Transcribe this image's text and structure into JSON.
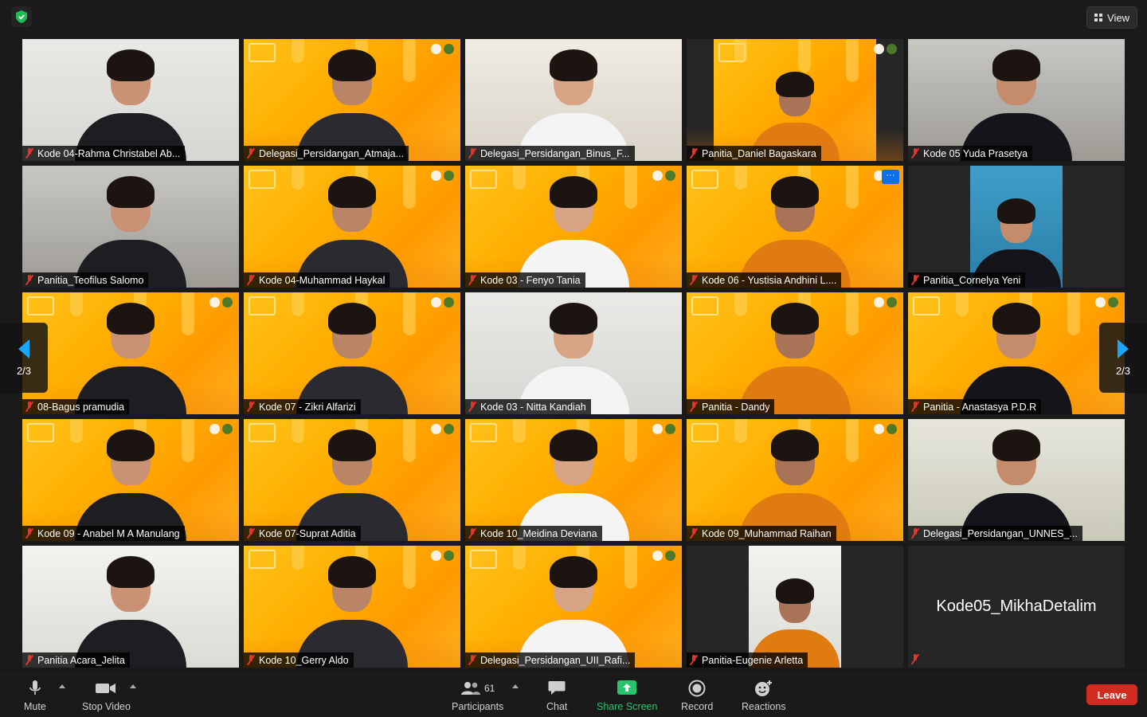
{
  "app": {
    "view_label": "View"
  },
  "pager": {
    "left": "2/3",
    "right": "2/3"
  },
  "tiles": [
    {
      "name": "Kode 04-Rahma Christabel Ab...",
      "bg": "white"
    },
    {
      "name": "Delegasi_Persidangan_Atmaja...",
      "bg": "orange"
    },
    {
      "name": "Delegasi_Persidangan_Binus_F...",
      "bg": "wood"
    },
    {
      "name": "Panitia_Daniel Bagaskara",
      "bg": "orange-inset"
    },
    {
      "name": "Kode 05 Yuda Prasetya",
      "bg": "room"
    },
    {
      "name": "Panitia_Teofilus Salomo",
      "bg": "room"
    },
    {
      "name": "Kode 04-Muhammad Haykal",
      "bg": "orange"
    },
    {
      "name": "Kode 03 - Fenyo Tania",
      "bg": "orange"
    },
    {
      "name": "Kode 06 - Yustisia Andhini L....",
      "bg": "orange",
      "more": "···"
    },
    {
      "name": "Panitia_Cornelya Yeni",
      "bg": "blue-inset"
    },
    {
      "name": "08-Bagus pramudia",
      "bg": "orange"
    },
    {
      "name": "Kode 07 - Zikri Alfarizi",
      "bg": "orange"
    },
    {
      "name": "Kode 03 - Nitta Kandiah",
      "bg": "white"
    },
    {
      "name": "Panitia - Dandy",
      "bg": "orange"
    },
    {
      "name": "Panitia - Anastasya P.D.R",
      "bg": "orange"
    },
    {
      "name": "Kode 09 - Anabel M A Manulang",
      "bg": "orange"
    },
    {
      "name": "Kode 07-Suprat Aditia",
      "bg": "orange"
    },
    {
      "name": "Kode 10_Meidina Deviana",
      "bg": "orange"
    },
    {
      "name": "Kode 09_Muhammad Raihan",
      "bg": "orange"
    },
    {
      "name": "Delegasi_Persidangan_UNNES_...",
      "bg": "green"
    },
    {
      "name": "Panitia Acara_Jelita",
      "bg": "light"
    },
    {
      "name": "Kode 10_Gerry Aldo",
      "bg": "orange"
    },
    {
      "name": "Delegasi_Persidangan_UII_Rafi...",
      "bg": "orange"
    },
    {
      "name": "Panitia-Eugenie Arletta",
      "bg": "light-inset"
    },
    {
      "name": "",
      "big_name": "Kode05_MikhaDetalim",
      "bg": "dark"
    }
  ],
  "toolbar": {
    "mute": "Mute",
    "stop_video": "Stop Video",
    "participants": "Participants",
    "participants_count": "61",
    "chat": "Chat",
    "share_screen": "Share Screen",
    "record": "Record",
    "reactions": "Reactions",
    "leave": "Leave"
  },
  "colors": {
    "accent_blue": "#0e71eb",
    "leave_red": "#d22b1f",
    "share_green": "#27c56b",
    "muted_red": "#e0362f"
  }
}
